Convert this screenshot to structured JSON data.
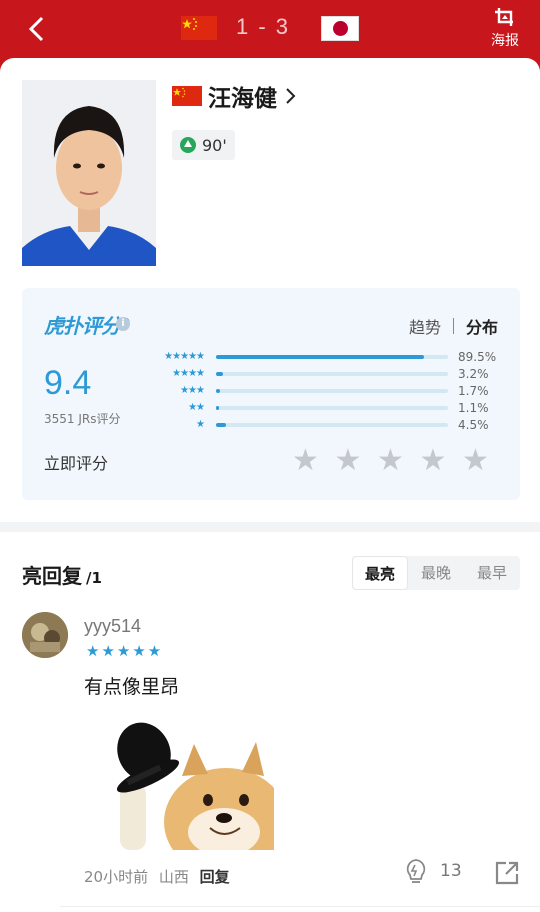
{
  "header": {
    "score": "1 - 3",
    "poster_label": "海报"
  },
  "player": {
    "name": "汪海健",
    "sub_minute": "90'"
  },
  "rating": {
    "logo": "虎扑评分",
    "tab_trend": "趋势",
    "tab_dist": "分布",
    "score": "9.4",
    "votes": "3551 JRs评分",
    "distribution": [
      {
        "stars": "★★★★★",
        "pct": "89.5%",
        "value": 0.895
      },
      {
        "stars": "★★★★",
        "pct": "3.2%",
        "value": 0.032
      },
      {
        "stars": "★★★",
        "pct": "1.7%",
        "value": 0.017
      },
      {
        "stars": "★★",
        "pct": "1.1%",
        "value": 0.011
      },
      {
        "stars": "★",
        "pct": "4.5%",
        "value": 0.045
      }
    ],
    "rate_now": "立即评分"
  },
  "replies": {
    "title": "亮回复",
    "count": "/1",
    "sort": [
      "最亮",
      "最晚",
      "最早"
    ]
  },
  "comment": {
    "user": "yyy514",
    "stars": "★★★★★",
    "text": "有点像里昂",
    "time": "20小时前",
    "location": "山西",
    "reply": "回复",
    "likes": "13"
  },
  "colors": {
    "brand_red": "#c8161d",
    "accent_blue": "#2d9ad6"
  }
}
